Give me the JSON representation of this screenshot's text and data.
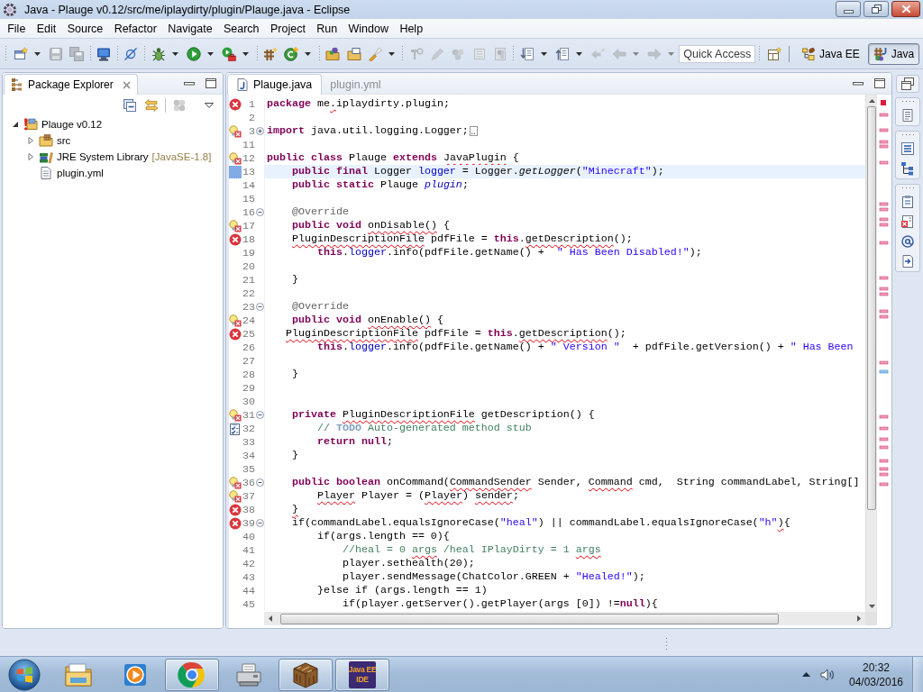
{
  "window": {
    "title": "Java - Plauge v0.12/src/me/iplaydirty/plugin/Plauge.java - Eclipse"
  },
  "menu": [
    "File",
    "Edit",
    "Source",
    "Refactor",
    "Navigate",
    "Search",
    "Project",
    "Run",
    "Window",
    "Help"
  ],
  "toolbar": {
    "groups": [
      [
        {
          "kind": "new",
          "dropdown": true,
          "disabled": false
        },
        {
          "kind": "save",
          "dropdown": false,
          "disabled": true
        },
        {
          "kind": "save_all",
          "dropdown": false,
          "disabled": true
        }
      ],
      [
        {
          "kind": "terminal",
          "dropdown": false,
          "disabled": false
        }
      ],
      [
        {
          "kind": "skip_breakpoints",
          "dropdown": false,
          "disabled": false
        }
      ],
      [
        {
          "kind": "debug",
          "dropdown": true,
          "disabled": false
        },
        {
          "kind": "run",
          "dropdown": true,
          "disabled": false
        },
        {
          "kind": "external_tools",
          "dropdown": true,
          "disabled": false
        }
      ],
      [
        {
          "kind": "new_package",
          "dropdown": false,
          "disabled": false
        },
        {
          "kind": "new_class",
          "dropdown": true,
          "disabled": false
        }
      ],
      [
        {
          "kind": "open_type",
          "dropdown": false,
          "disabled": false
        },
        {
          "kind": "open_task",
          "dropdown": false,
          "disabled": false
        },
        {
          "kind": "search",
          "dropdown": true,
          "disabled": false
        }
      ],
      [
        {
          "kind": "mark_occurrences",
          "dropdown": false,
          "disabled": true
        },
        {
          "kind": "highlight",
          "dropdown": false,
          "disabled": true
        },
        {
          "kind": "breadcrumb",
          "dropdown": false,
          "disabled": true
        },
        {
          "kind": "block_select",
          "dropdown": false,
          "disabled": true
        },
        {
          "kind": "whitespace",
          "dropdown": false,
          "disabled": true
        }
      ],
      [
        {
          "kind": "next_annotation",
          "dropdown": true,
          "disabled": false
        },
        {
          "kind": "prev_annotation",
          "dropdown": true,
          "disabled": false
        },
        {
          "kind": "last_edit",
          "dropdown": false,
          "disabled": true
        },
        {
          "kind": "back",
          "dropdown": true,
          "disabled": true
        },
        {
          "kind": "forward",
          "dropdown": true,
          "disabled": true
        }
      ]
    ],
    "quick_access": {
      "placeholder": "Quick Access"
    },
    "perspectives": [
      {
        "label": "Java EE",
        "kind": "javaee",
        "selected": false
      },
      {
        "label": "Java",
        "kind": "java",
        "selected": true
      }
    ]
  },
  "package_explorer": {
    "title": "Package Explorer",
    "view_toolbar": [
      [
        {
          "kind": "collapse_all",
          "disabled": false
        },
        {
          "kind": "link_editor",
          "disabled": false
        }
      ],
      [
        {
          "kind": "filter",
          "disabled": true
        },
        {
          "kind": "view_menu",
          "disabled": false
        }
      ]
    ],
    "tree": [
      {
        "label": "Plauge v0.12",
        "kind": "project",
        "expanded": true,
        "children": [
          {
            "label": "src",
            "kind": "source_folder",
            "expanded": false
          },
          {
            "label": "JRE System Library",
            "decoration": "[JavaSE-1.8]",
            "kind": "library",
            "expanded": false
          },
          {
            "label": "plugin.yml",
            "kind": "file"
          }
        ]
      }
    ]
  },
  "editor": {
    "tabs": [
      {
        "label": "Plauge.java",
        "kind": "java",
        "selected": true
      },
      {
        "label": "plugin.yml",
        "kind": "text",
        "selected": false
      }
    ],
    "lines": [
      {
        "number": "1",
        "marker": {
          "kind": "error"
        },
        "current": false,
        "segments": [
          {
            "text": "package",
            "kind": "keyword"
          },
          {
            "text": " me",
            "kind": "plain"
          },
          {
            "text": ".",
            "kind": "plain",
            "squiggle": true
          },
          {
            "text": "iplaydirty.plugin;",
            "kind": "plain"
          }
        ]
      },
      {
        "number": "2",
        "current": false
      },
      {
        "number": "3",
        "marker": {
          "kind": "quickfix_error"
        },
        "fold": {
          "kind": "expand"
        },
        "current": false,
        "segments": [
          {
            "text": "import",
            "kind": "keyword"
          },
          {
            "text": " java.util.logging.Logger;",
            "kind": "plain"
          }
        ]
      },
      {
        "number": "11",
        "current": false
      },
      {
        "number": "12",
        "marker": {
          "kind": "quickfix_error"
        },
        "current": false,
        "segments": [
          {
            "text": "public class",
            "kind": "keyword"
          },
          {
            "text": " Plauge ",
            "kind": "plain"
          },
          {
            "text": "extends",
            "kind": "keyword"
          },
          {
            "text": " JavaPlugin",
            "kind": "plain",
            "squiggle": true
          },
          {
            "text": " {",
            "kind": "plain"
          }
        ]
      },
      {
        "number": "13",
        "marker": {
          "kind": "occurrence"
        },
        "current": true,
        "segments": [
          {
            "text": "    public final",
            "kind": "keyword"
          },
          {
            "text": " Logger ",
            "kind": "plain"
          },
          {
            "text": "logger",
            "kind": "field"
          },
          {
            "text": " = Logger.",
            "kind": "plain"
          },
          {
            "text": "getLogger",
            "kind": "static_method"
          },
          {
            "text": "(",
            "kind": "plain"
          },
          {
            "text": "\"Minecraft\"",
            "kind": "string"
          },
          {
            "text": ");",
            "kind": "plain"
          }
        ]
      },
      {
        "number": "14",
        "current": false,
        "segments": [
          {
            "text": "    public static",
            "kind": "keyword"
          },
          {
            "text": " Plauge ",
            "kind": "plain"
          },
          {
            "text": "plugin",
            "kind": "static_field"
          },
          {
            "text": ";",
            "kind": "plain"
          }
        ]
      },
      {
        "number": "15",
        "current": false
      },
      {
        "number": "16",
        "fold": {
          "kind": "collapse"
        },
        "current": false,
        "segments": [
          {
            "text": "    @Override",
            "kind": "annotation"
          }
        ]
      },
      {
        "number": "17",
        "marker": {
          "kind": "quickfix_error"
        },
        "current": false,
        "segments": [
          {
            "text": "    public void",
            "kind": "keyword"
          },
          {
            "text": " onDisable()",
            "kind": "plain",
            "squiggle": true
          },
          {
            "text": " {",
            "kind": "plain"
          }
        ]
      },
      {
        "number": "18",
        "marker": {
          "kind": "error"
        },
        "current": false,
        "segments": [
          {
            "text": "    PluginDescriptionFile",
            "kind": "plain",
            "squiggle": true
          },
          {
            "text": " pdfFile = ",
            "kind": "plain"
          },
          {
            "text": "this",
            "kind": "keyword"
          },
          {
            "text": ".",
            "kind": "plain"
          },
          {
            "text": "getDescription",
            "kind": "plain",
            "squiggle": true
          },
          {
            "text": "();",
            "kind": "plain"
          }
        ]
      },
      {
        "number": "19",
        "current": false,
        "segments": [
          {
            "text": "        this",
            "kind": "keyword"
          },
          {
            "text": ".",
            "kind": "plain"
          },
          {
            "text": "logger",
            "kind": "field"
          },
          {
            "text": ".info(pdfFile.getName() +  ",
            "kind": "plain"
          },
          {
            "text": "\" Has Been Disabled!\"",
            "kind": "string"
          },
          {
            "text": ");",
            "kind": "plain"
          }
        ]
      },
      {
        "number": "20",
        "current": false
      },
      {
        "number": "21",
        "current": false,
        "segments": [
          {
            "text": "    }",
            "kind": "plain"
          }
        ]
      },
      {
        "number": "22",
        "current": false
      },
      {
        "number": "23",
        "fold": {
          "kind": "collapse"
        },
        "current": false,
        "segments": [
          {
            "text": "    @Override",
            "kind": "annotation"
          }
        ]
      },
      {
        "number": "24",
        "marker": {
          "kind": "quickfix_error"
        },
        "current": false,
        "segments": [
          {
            "text": "    public void",
            "kind": "keyword"
          },
          {
            "text": " onEnable()",
            "kind": "plain",
            "squiggle": true
          },
          {
            "text": " {",
            "kind": "plain"
          }
        ]
      },
      {
        "number": "25",
        "marker": {
          "kind": "error"
        },
        "current": false,
        "segments": [
          {
            "text": "   PluginDescriptionFile",
            "kind": "plain",
            "squiggle": true
          },
          {
            "text": " pdfFile = ",
            "kind": "plain"
          },
          {
            "text": "this",
            "kind": "keyword"
          },
          {
            "text": ".",
            "kind": "plain"
          },
          {
            "text": "getDescription",
            "kind": "plain",
            "squiggle": true
          },
          {
            "text": "();",
            "kind": "plain"
          }
        ]
      },
      {
        "number": "26",
        "current": false,
        "segments": [
          {
            "text": "        this",
            "kind": "keyword"
          },
          {
            "text": ".",
            "kind": "plain"
          },
          {
            "text": "logger",
            "kind": "field"
          },
          {
            "text": ".info(pdfFile.getName() + ",
            "kind": "plain"
          },
          {
            "text": "\" Version \"",
            "kind": "string"
          },
          {
            "text": "  + pdfFile.getVersion() + ",
            "kind": "plain"
          },
          {
            "text": "\" Has Been",
            "kind": "string"
          }
        ]
      },
      {
        "number": "27",
        "current": false
      },
      {
        "number": "28",
        "current": false,
        "segments": [
          {
            "text": "    }",
            "kind": "plain"
          }
        ]
      },
      {
        "number": "29",
        "current": false
      },
      {
        "number": "30",
        "current": false
      },
      {
        "number": "31",
        "marker": {
          "kind": "quickfix_error"
        },
        "fold": {
          "kind": "collapse"
        },
        "current": false,
        "segments": [
          {
            "text": "    private",
            "kind": "keyword"
          },
          {
            "text": " PluginDescriptionFile",
            "kind": "plain",
            "squiggle": true
          },
          {
            "text": " getDescription() {",
            "kind": "plain"
          }
        ]
      },
      {
        "number": "32",
        "marker": {
          "kind": "task"
        },
        "current": false,
        "segments": [
          {
            "text": "        // ",
            "kind": "comment"
          },
          {
            "text": "TODO",
            "kind": "todo"
          },
          {
            "text": " Auto-generated method stub",
            "kind": "comment"
          }
        ]
      },
      {
        "number": "33",
        "current": false,
        "segments": [
          {
            "text": "        return null",
            "kind": "keyword"
          },
          {
            "text": ";",
            "kind": "plain"
          }
        ]
      },
      {
        "number": "34",
        "current": false,
        "segments": [
          {
            "text": "    }",
            "kind": "plain"
          }
        ]
      },
      {
        "number": "35",
        "current": false
      },
      {
        "number": "36",
        "marker": {
          "kind": "quickfix_error"
        },
        "fold": {
          "kind": "collapse"
        },
        "current": false,
        "segments": [
          {
            "text": "    public boolean",
            "kind": "keyword"
          },
          {
            "text": " onCommand(",
            "kind": "plain"
          },
          {
            "text": "CommandSender",
            "kind": "plain",
            "squiggle": true
          },
          {
            "text": " Sender, ",
            "kind": "plain"
          },
          {
            "text": "Command",
            "kind": "plain",
            "squiggle": true
          },
          {
            "text": " cmd,  String commandLabel, String[]",
            "kind": "plain"
          }
        ]
      },
      {
        "number": "37",
        "marker": {
          "kind": "quickfix_error"
        },
        "current": false,
        "segments": [
          {
            "text": "        Player",
            "kind": "plain",
            "squiggle": true
          },
          {
            "text": " Player = (",
            "kind": "plain"
          },
          {
            "text": "Player",
            "kind": "plain",
            "squiggle": true
          },
          {
            "text": ") ",
            "kind": "plain"
          },
          {
            "text": "sender",
            "kind": "plain",
            "squiggle": true
          },
          {
            "text": ";",
            "kind": "plain"
          }
        ]
      },
      {
        "number": "38",
        "marker": {
          "kind": "error"
        },
        "current": false,
        "segments": [
          {
            "text": "    }",
            "kind": "plain",
            "squiggle": true
          }
        ]
      },
      {
        "number": "39",
        "marker": {
          "kind": "error"
        },
        "fold": {
          "kind": "collapse"
        },
        "current": false,
        "segments": [
          {
            "text": "    if(commandLabel.equalsIgnoreCase(",
            "kind": "plain"
          },
          {
            "text": "\"heal\"",
            "kind": "string"
          },
          {
            "text": ") || commandLabel.equalsIgnoreCase(",
            "kind": "plain"
          },
          {
            "text": "\"h\"",
            "kind": "string"
          },
          {
            "text": ")",
            "kind": "plain",
            "squiggle": true
          },
          {
            "text": "{",
            "kind": "plain"
          }
        ]
      },
      {
        "number": "40",
        "current": false,
        "segments": [
          {
            "text": "        if(args.length == 0){",
            "kind": "plain"
          }
        ]
      },
      {
        "number": "41",
        "current": false,
        "segments": [
          {
            "text": "            //heal = 0 ",
            "kind": "comment"
          },
          {
            "text": "args",
            "kind": "comment",
            "squiggle": true
          },
          {
            "text": " /heal IPlayDirty = 1 ",
            "kind": "comment"
          },
          {
            "text": "args",
            "kind": "comment",
            "squiggle": true
          }
        ]
      },
      {
        "number": "42",
        "current": false,
        "segments": [
          {
            "text": "            player.sethealth(20);",
            "kind": "plain"
          }
        ]
      },
      {
        "number": "43",
        "current": false,
        "segments": [
          {
            "text": "            player.sendMessage(ChatColor.GREEN + ",
            "kind": "plain"
          },
          {
            "text": "\"Healed!\"",
            "kind": "string"
          },
          {
            "text": ");",
            "kind": "plain"
          }
        ]
      },
      {
        "number": "44",
        "current": false,
        "segments": [
          {
            "text": "        }else if (args.length == 1)",
            "kind": "plain"
          }
        ]
      },
      {
        "number": "45",
        "current": false,
        "segments": [
          {
            "text": "            if(player.getServer().getPlayer(args [0]) !=",
            "kind": "plain"
          },
          {
            "text": "null",
            "kind": "keyword"
          },
          {
            "text": "){",
            "kind": "plain"
          }
        ]
      }
    ]
  },
  "taskbar": {
    "apps": [
      {
        "kind": "explorer",
        "running": false
      },
      {
        "kind": "media_player",
        "running": false
      },
      {
        "kind": "browser",
        "running": true
      },
      {
        "kind": "fax",
        "running": false
      },
      {
        "kind": "crafting_table",
        "running": true
      },
      {
        "kind": "ide",
        "running": true,
        "icon_text": [
          "Java EE",
          "IDE"
        ]
      }
    ],
    "clock": {
      "time": "20:32",
      "date": "04/03/2016"
    }
  }
}
